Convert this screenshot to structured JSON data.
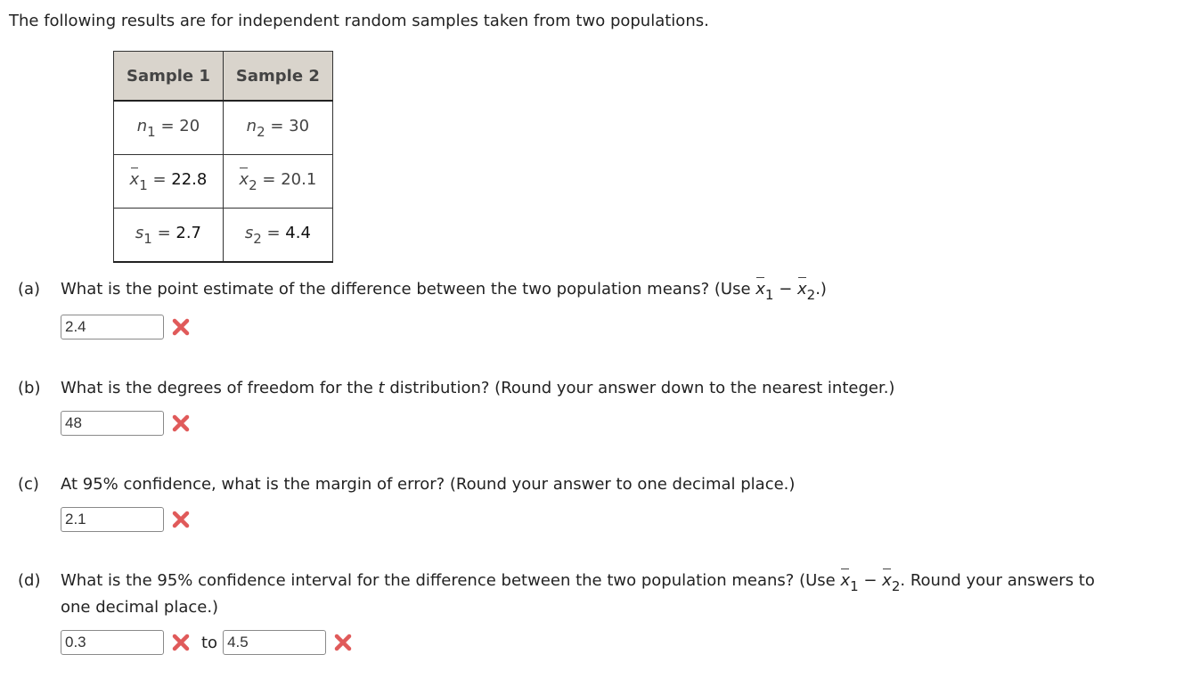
{
  "intro": "The following results are for independent random samples taken from two populations.",
  "table": {
    "headers": [
      "Sample 1",
      "Sample 2"
    ],
    "rows": [
      [
        {
          "sym": "n",
          "sub": "1",
          "val": "20"
        },
        {
          "sym": "n",
          "sub": "2",
          "val": "30"
        }
      ],
      [
        {
          "sym": "x",
          "sub": "1",
          "val": "22.8"
        },
        {
          "sym": "x",
          "sub": "2",
          "val": "20.1"
        }
      ],
      [
        {
          "sym": "s",
          "sub": "1",
          "val": "2.7"
        },
        {
          "sym": "s",
          "sub": "2",
          "val": "4.4"
        }
      ]
    ]
  },
  "questions": {
    "a": {
      "label": "(a)",
      "text": "What is the point estimate of the difference between the two population means? (Use ",
      "text_end": ".)",
      "answer": "2.4",
      "status_icon": "incorrect-x-icon"
    },
    "b": {
      "label": "(b)",
      "text_pre": "What is the degrees of freedom for the ",
      "t": "t",
      "text_post": " distribution? (Round your answer down to the nearest integer.)",
      "answer": "48",
      "status_icon": "incorrect-x-icon"
    },
    "c": {
      "label": "(c)",
      "text": "At 95% confidence, what is the margin of error? (Round your answer to one decimal place.)",
      "answer": "2.1",
      "status_icon": "incorrect-x-icon"
    },
    "d": {
      "label": "(d)",
      "text": "What is the 95% confidence interval for the difference between the two population means? (Use ",
      "text_end": ". Round your answers to",
      "text_line2": "one decimal place.)",
      "answer_low": "0.3",
      "to_label": "to",
      "answer_high": "4.5",
      "status_icon": "incorrect-x-icon"
    }
  },
  "math": {
    "eq": " = ",
    "minus": " − ",
    "x": "x",
    "one": "1",
    "two": "2"
  },
  "colors": {
    "incorrect": "#e05a5a",
    "header_bg": "#d9d4cc"
  }
}
